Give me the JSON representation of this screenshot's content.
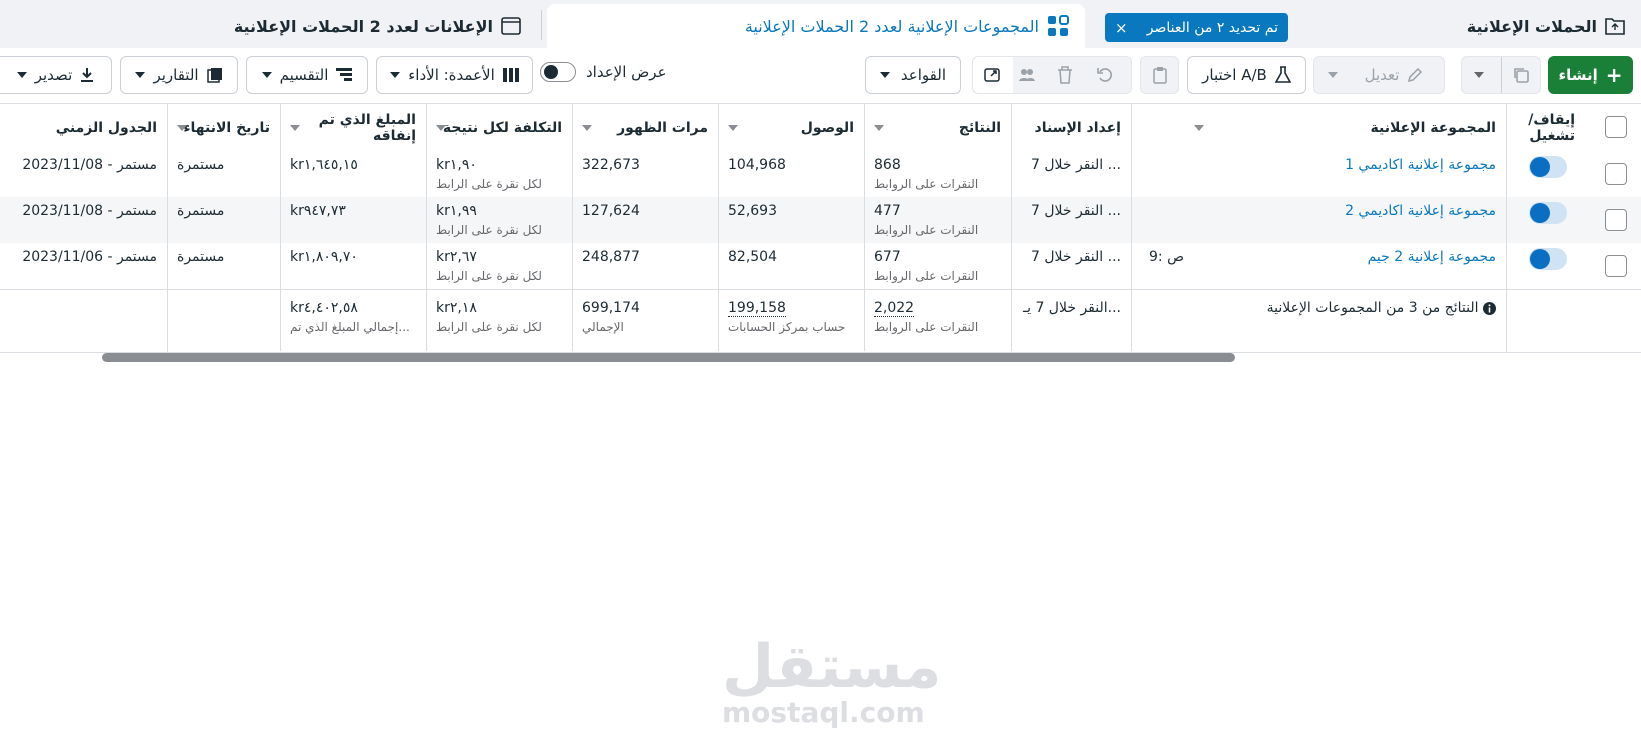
{
  "tabs": {
    "campaigns": "الحملات الإعلانية",
    "selection_badge": "تم تحديد ٢ من العناصر",
    "selection_close": "×",
    "adsets": "المجموعات الإعلانية لعدد 2 الحملات الإعلانية",
    "ads": "الإعلانات لعدد 2 الحملات الإعلانية"
  },
  "toolbar": {
    "create": "إنشاء",
    "edit": "تعديل",
    "ab_test": "اختبار A/B",
    "rules": "القواعد",
    "view_setup": "عرض الإعداد",
    "columns": "الأعمدة: الأداء",
    "breakdown": "التقسيم",
    "reports": "التقارير",
    "export": "تصدير"
  },
  "columns": {
    "on_off": "إيقاف/ تشغيل",
    "adset": "المجموعة الإعلانية",
    "attribution": "إعداد الإسناد",
    "results": "النتائج",
    "reach": "الوصول",
    "impressions": "مرات الظهور",
    "cost_per_result": "التكلفة لكل نتيجة",
    "amount_spent": "المبلغ الذي تم إنفاقه",
    "end_date": "تاريخ الانتهاء",
    "schedule": "الجدول الزمني"
  },
  "rows": [
    {
      "name": "مجموعة إعلانية اكاديمي 1",
      "extra": "",
      "attribution": "النقر خلال 7 ...",
      "results": "868",
      "results_sub": "النقرات على الروابط",
      "reach": "104,968",
      "impressions": "322,673",
      "cost": "kr١,٩٠",
      "cost_sub": "لكل نقرة على الرابط",
      "spent": "kr١,٦٤٥,١٥",
      "end": "مستمرة",
      "schedule": "2023/11/08 - مستمر",
      "enabled": true
    },
    {
      "name": "مجموعة إعلانية اكاديمي 2",
      "extra": "",
      "attribution": "النقر خلال 7 ...",
      "results": "477",
      "results_sub": "النقرات على الروابط",
      "reach": "52,693",
      "impressions": "127,624",
      "cost": "kr١,٩٩",
      "cost_sub": "لكل نقرة على الرابط",
      "spent": "kr٩٤٧,٧٣",
      "end": "مستمرة",
      "schedule": "2023/11/08 - مستمر",
      "enabled": true
    },
    {
      "name": "مجموعة إعلانية 2 جيم",
      "extra": "9: ص",
      "attribution": "النقر خلال 7 ...",
      "results": "677",
      "results_sub": "النقرات على الروابط",
      "reach": "82,504",
      "impressions": "248,877",
      "cost": "kr٢,٦٧",
      "cost_sub": "لكل نقرة على الرابط",
      "spent": "kr١,٨٠٩,٧٠",
      "end": "مستمرة",
      "schedule": "2023/11/06 - مستمر",
      "enabled": true
    }
  ],
  "totals": {
    "label": "النتائج من 3 من المجموعات الإعلانية",
    "attribution": "النقر خلال 7 يـ...",
    "results": "2,022",
    "results_sub": "النقرات على الروابط",
    "reach": "199,158",
    "reach_sub": "حساب بمركز الحسابات",
    "impressions": "699,174",
    "impressions_sub": "الإجمالي",
    "cost": "kr٢,١٨",
    "cost_sub": "لكل نقرة على الرابط",
    "spent": "kr٤,٤٠٢,٥٨",
    "spent_sub": "إجمالي المبلغ الذي تم..."
  },
  "watermark": {
    "arabic": "مستقل",
    "latin": "mostaql.com"
  },
  "colors": {
    "primary_green": "#1a7f37",
    "link_blue": "#0a78be",
    "toggle_blue": "#0a6fc2"
  }
}
